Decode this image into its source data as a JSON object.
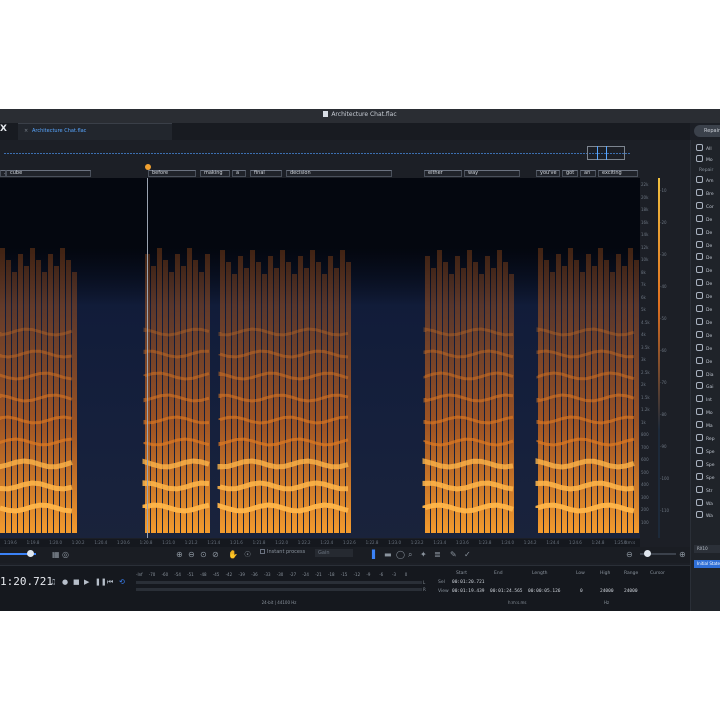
{
  "window": {
    "title": "Architecture Chat.flac",
    "logo": "X"
  },
  "tab": {
    "label": "Architecture Chat.flac"
  },
  "header": {
    "right_button": "Repair"
  },
  "words": [
    "...",
    "cube",
    "before",
    "making",
    "a",
    "final",
    "decision",
    "either",
    "way",
    "you've",
    "got",
    "an",
    "exciting"
  ],
  "freq_labels": [
    "22k",
    "20k",
    "18k",
    "16k",
    "14k",
    "12k",
    "10k",
    "8k",
    "7k",
    "6k",
    "5k",
    "4.5k",
    "4k",
    "3.5k",
    "3k",
    "2.5k",
    "2k",
    "1.5k",
    "1.2k",
    "1k",
    "800",
    "700",
    "600",
    "500",
    "400",
    "300",
    "200",
    "100"
  ],
  "db_labels": [
    "-10",
    "-20",
    "-30",
    "-40",
    "-50",
    "-60",
    "-70",
    "-80",
    "-90",
    "-100",
    "-110"
  ],
  "time_labels": [
    "1:19.6",
    "1:19.8",
    "1:20.0",
    "1:20.2",
    "1:20.4",
    "1:20.6",
    "1:20.8",
    "1:21.0",
    "1:21.2",
    "1:21.4",
    "1:21.6",
    "1:21.8",
    "1:22.0",
    "1:22.2",
    "1:22.4",
    "1:22.6",
    "1:22.8",
    "1:23.0",
    "1:23.2",
    "1:23.4",
    "1:23.6",
    "1:23.8",
    "1:24.0",
    "1:24.2",
    "1:24.4",
    "1:24.6",
    "1:24.8",
    "1:25.0"
  ],
  "time_units": "h:m:s",
  "toolbar": {
    "instant_process": "Instant process",
    "mode": "Gain",
    "zoom_level": 0.82,
    "hzoom_level": 0.2
  },
  "transport": {
    "timecode": "1:20.721",
    "level_numbers": [
      "-Inf",
      "-70",
      "-60",
      "-54",
      "-51",
      "-48",
      "-45",
      "-42",
      "-39",
      "-36",
      "-33",
      "-30",
      "-27",
      "-24",
      "-21",
      "-18",
      "-15",
      "-12",
      "-9",
      "-6",
      "-3",
      "0"
    ],
    "format": "24-bit | 44100 Hz",
    "L": "L",
    "R": "R"
  },
  "selection": {
    "headers": {
      "start": "Start",
      "end": "End",
      "length": "Length",
      "low": "Low",
      "high": "High",
      "range": "Range",
      "cursor": "Cursor"
    },
    "sel_label": "Sel",
    "view_label": "View",
    "sel": {
      "start": "00:01:20.721",
      "end": "",
      "length": ""
    },
    "view": {
      "start": "00:01:19.439",
      "end": "00:01:24.565",
      "length": "00:00:05.126",
      "low": "0",
      "high": "24000",
      "range": "24000"
    },
    "time_unit": "h:m:s.ms",
    "freq_unit": "Hz"
  },
  "sidebar": {
    "top": [
      "All",
      "Mo"
    ],
    "section": "Repair",
    "modules": [
      "Am",
      "Bre",
      "Cor",
      "De",
      "De",
      "De",
      "De",
      "De",
      "De",
      "De",
      "De",
      "De",
      "De",
      "De",
      "De",
      "Dia",
      "Gai",
      "Int",
      "Mo",
      "Ma",
      "Rep",
      "Spe",
      "Spe",
      "Spe",
      "Str",
      "Wa",
      "Wa"
    ],
    "bottom_button": "Initial State",
    "preset": "RX10"
  }
}
